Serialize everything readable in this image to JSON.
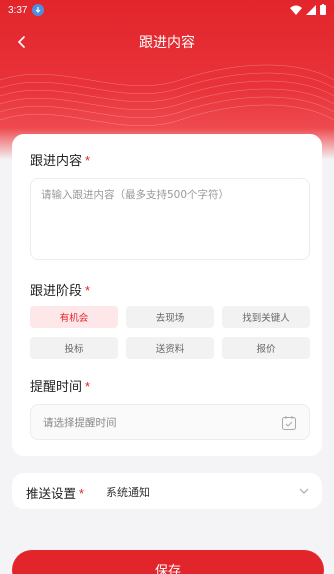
{
  "status_bar": {
    "time": "3:37"
  },
  "header": {
    "title": "跟进内容"
  },
  "form": {
    "content": {
      "label": "跟进内容",
      "required_mark": "*",
      "placeholder": "请输入跟进内容（最多支持500个字符）"
    },
    "stage": {
      "label": "跟进阶段",
      "required_mark": "*",
      "options": [
        "有机会",
        "去现场",
        "找到关键人",
        "投标",
        "送资料",
        "报价"
      ],
      "selected": "有机会"
    },
    "reminder": {
      "label": "提醒时间",
      "required_mark": "*",
      "placeholder": "请选择提醒时间"
    },
    "push": {
      "label": "推送设置",
      "required_mark": "*",
      "value": "系统通知"
    }
  },
  "actions": {
    "save_label": "保存"
  },
  "colors": {
    "accent": "#e2252b",
    "selected_bg": "#fde7e8",
    "page_bg": "#f4f4f6"
  },
  "icons": [
    "download-icon",
    "wifi-icon",
    "signal-icon",
    "battery-icon",
    "back-arrow-icon",
    "calendar-icon",
    "chevron-down-icon"
  ]
}
